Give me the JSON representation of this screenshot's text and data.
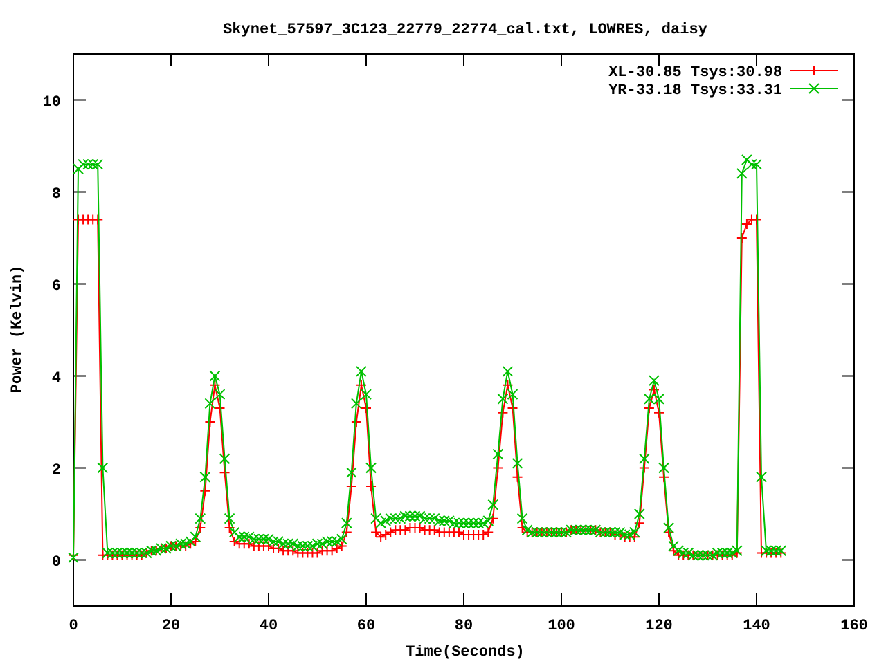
{
  "chart_data": {
    "type": "line",
    "title": "Skynet_57597_3C123_22779_22774_cal.txt, LOWRES, daisy",
    "xlabel": "Time(Seconds)",
    "ylabel": "Power (Kelvin)",
    "x": [
      0,
      1,
      2,
      3,
      4,
      5,
      6,
      7,
      8,
      9,
      10,
      11,
      12,
      13,
      14,
      15,
      16,
      17,
      18,
      19,
      20,
      21,
      22,
      23,
      24,
      25,
      26,
      27,
      28,
      29,
      30,
      31,
      32,
      33,
      34,
      35,
      36,
      37,
      38,
      39,
      40,
      41,
      42,
      43,
      44,
      45,
      46,
      47,
      48,
      49,
      50,
      51,
      52,
      53,
      54,
      55,
      56,
      57,
      58,
      59,
      60,
      61,
      62,
      63,
      64,
      65,
      66,
      67,
      68,
      69,
      70,
      71,
      72,
      73,
      74,
      75,
      76,
      77,
      78,
      79,
      80,
      81,
      82,
      83,
      84,
      85,
      86,
      87,
      88,
      89,
      90,
      91,
      92,
      93,
      94,
      95,
      96,
      97,
      98,
      99,
      100,
      101,
      102,
      103,
      104,
      105,
      106,
      107,
      108,
      109,
      110,
      111,
      112,
      113,
      114,
      115,
      116,
      117,
      118,
      119,
      120,
      121,
      122,
      123,
      124,
      125,
      126,
      127,
      128,
      129,
      130,
      131,
      132,
      133,
      134,
      135,
      136,
      137,
      138,
      139,
      140,
      141,
      142,
      143,
      144,
      145
    ],
    "series": [
      {
        "name": "XL-30.85 Tsys:30.98",
        "color": "#ff0000",
        "marker": "plus",
        "values": [
          0.1,
          7.4,
          7.4,
          7.4,
          7.4,
          7.4,
          0.1,
          0.1,
          0.1,
          0.1,
          0.1,
          0.1,
          0.1,
          0.1,
          0.1,
          0.15,
          0.2,
          0.2,
          0.25,
          0.25,
          0.3,
          0.3,
          0.3,
          0.3,
          0.35,
          0.4,
          0.7,
          1.5,
          3.0,
          3.8,
          3.3,
          1.9,
          0.7,
          0.4,
          0.35,
          0.35,
          0.35,
          0.3,
          0.3,
          0.3,
          0.3,
          0.25,
          0.25,
          0.2,
          0.2,
          0.2,
          0.15,
          0.15,
          0.15,
          0.15,
          0.15,
          0.2,
          0.2,
          0.2,
          0.25,
          0.3,
          0.6,
          1.6,
          3.0,
          3.8,
          3.3,
          1.6,
          0.6,
          0.5,
          0.55,
          0.6,
          0.65,
          0.65,
          0.65,
          0.7,
          0.7,
          0.7,
          0.65,
          0.65,
          0.65,
          0.6,
          0.6,
          0.6,
          0.6,
          0.6,
          0.55,
          0.55,
          0.55,
          0.55,
          0.55,
          0.6,
          0.9,
          2.0,
          3.2,
          3.8,
          3.3,
          1.8,
          0.7,
          0.6,
          0.6,
          0.6,
          0.6,
          0.6,
          0.6,
          0.6,
          0.6,
          0.6,
          0.65,
          0.65,
          0.65,
          0.65,
          0.65,
          0.65,
          0.6,
          0.6,
          0.6,
          0.55,
          0.55,
          0.5,
          0.5,
          0.5,
          0.8,
          2.0,
          3.3,
          3.7,
          3.2,
          1.8,
          0.6,
          0.2,
          0.1,
          0.1,
          0.1,
          0.1,
          0.1,
          0.1,
          0.1,
          0.1,
          0.1,
          0.1,
          0.1,
          0.1,
          0.15,
          7.0,
          7.3,
          7.4,
          7.4,
          0.15,
          0.15,
          0.15,
          0.15,
          0.15
        ]
      },
      {
        "name": "YR-33.18 Tsys:33.31",
        "color": "#00c000",
        "marker": "cross",
        "values": [
          0.05,
          8.5,
          8.6,
          8.6,
          8.6,
          8.6,
          2.0,
          0.15,
          0.15,
          0.15,
          0.15,
          0.15,
          0.15,
          0.15,
          0.15,
          0.15,
          0.2,
          0.2,
          0.25,
          0.25,
          0.3,
          0.3,
          0.35,
          0.35,
          0.4,
          0.5,
          0.9,
          1.8,
          3.4,
          4.0,
          3.6,
          2.2,
          0.9,
          0.6,
          0.5,
          0.5,
          0.5,
          0.45,
          0.45,
          0.45,
          0.45,
          0.4,
          0.4,
          0.35,
          0.35,
          0.35,
          0.3,
          0.3,
          0.3,
          0.3,
          0.35,
          0.35,
          0.4,
          0.4,
          0.4,
          0.45,
          0.8,
          1.9,
          3.4,
          4.1,
          3.6,
          2.0,
          0.9,
          0.8,
          0.85,
          0.9,
          0.9,
          0.9,
          0.95,
          0.95,
          0.95,
          0.95,
          0.9,
          0.9,
          0.9,
          0.85,
          0.85,
          0.85,
          0.8,
          0.8,
          0.8,
          0.8,
          0.8,
          0.8,
          0.8,
          0.85,
          1.2,
          2.3,
          3.5,
          4.1,
          3.6,
          2.1,
          0.9,
          0.65,
          0.6,
          0.6,
          0.6,
          0.6,
          0.6,
          0.6,
          0.6,
          0.6,
          0.65,
          0.65,
          0.65,
          0.65,
          0.65,
          0.65,
          0.6,
          0.6,
          0.6,
          0.6,
          0.6,
          0.55,
          0.55,
          0.6,
          1.0,
          2.2,
          3.5,
          3.9,
          3.5,
          2.0,
          0.7,
          0.3,
          0.2,
          0.15,
          0.15,
          0.1,
          0.1,
          0.1,
          0.1,
          0.1,
          0.15,
          0.15,
          0.15,
          0.15,
          0.2,
          8.4,
          8.7,
          8.6,
          8.6,
          1.8,
          0.2,
          0.2,
          0.2,
          0.2
        ]
      }
    ],
    "legend": "top-right",
    "xlim": [
      0,
      160
    ],
    "ylim": [
      -1,
      11
    ],
    "xticks": [
      0,
      20,
      40,
      60,
      80,
      100,
      120,
      140,
      160
    ],
    "yticks": [
      0,
      2,
      4,
      6,
      8,
      10
    ]
  }
}
